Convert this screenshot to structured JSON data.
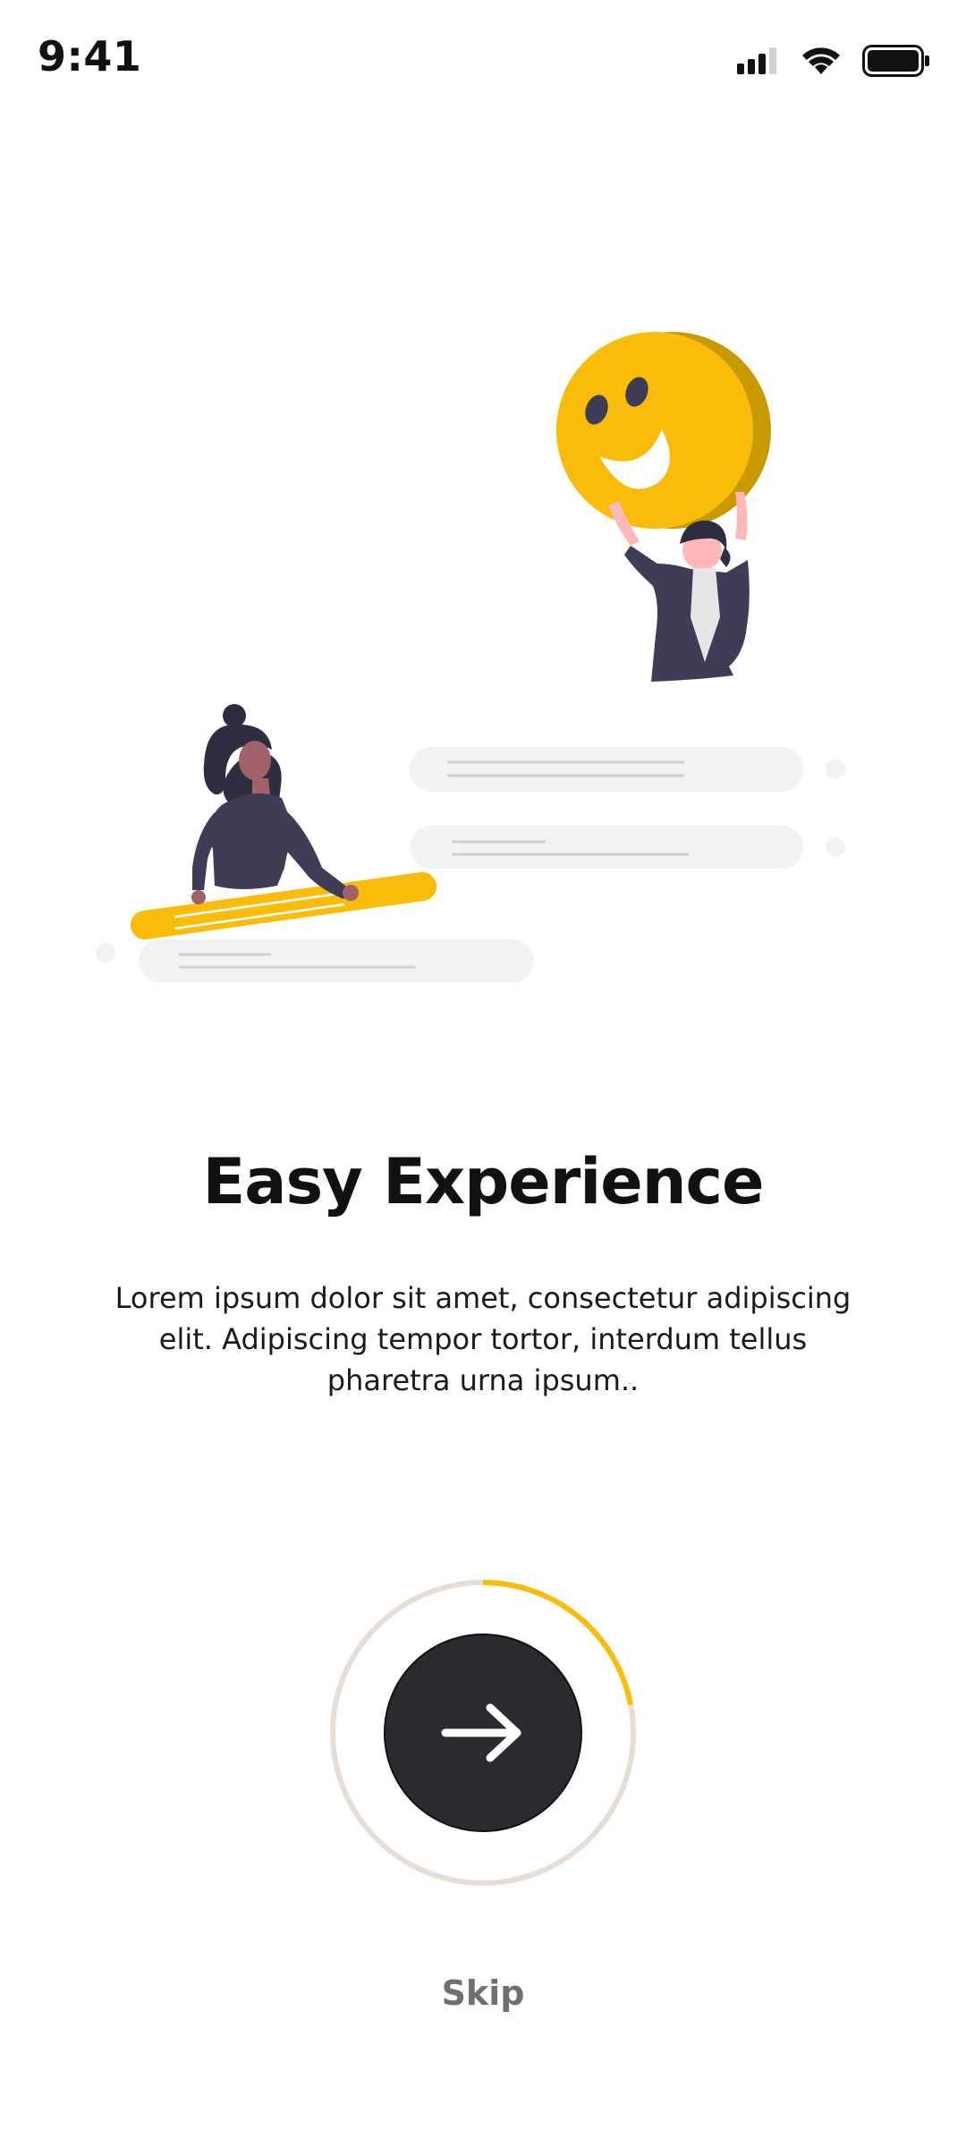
{
  "status_bar": {
    "time": "9:41",
    "icons": [
      "cellular-signal-icon",
      "wifi-icon",
      "battery-icon"
    ]
  },
  "illustration": {
    "name": "onboarding-illustration"
  },
  "onboarding": {
    "title": "Easy Experience",
    "description": "Lorem ipsum dolor sit amet, consectetur adipiscing elit. Adipiscing tempor tortor, interdum tellus pharetra urna ipsum..",
    "progress_fraction": 0.22,
    "next_icon": "arrow-right-icon",
    "skip_label": "Skip"
  },
  "colors": {
    "accent": "#F9BC0A",
    "accent_dark": "#C99A00",
    "button": "#2A2B2E",
    "ring_track": "#E6DED6",
    "skip_text": "#6F6F6F",
    "figure": "#3F3D56",
    "bubble": "#F2F2F2"
  }
}
